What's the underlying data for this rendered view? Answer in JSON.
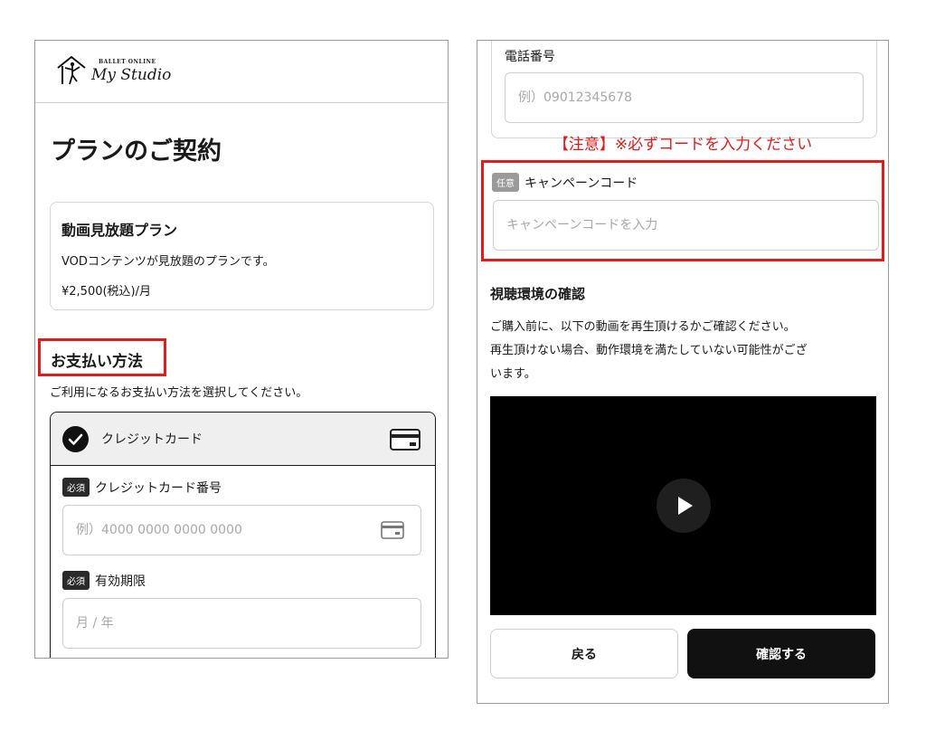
{
  "logo": {
    "small_text": "BALLET ONLINE",
    "main_text": "My Studio"
  },
  "page": {
    "title": "プランのご契約"
  },
  "plan": {
    "name": "動画見放題プラン",
    "description": "VODコンテンツが見放題のプランです。",
    "price": "¥2,500(税込)/月"
  },
  "payment": {
    "section_title": "お支払い方法",
    "description": "ご利用になるお支払い方法を選択してください。",
    "method_label": "クレジットカード",
    "required_badge": "必須",
    "card_number_label": "クレジットカード番号",
    "card_number_placeholder": "例）4000 0000 0000 0000",
    "expiry_label": "有効期限",
    "expiry_placeholder": "月 / 年"
  },
  "phone": {
    "label": "電話番号",
    "placeholder": "例）09012345678"
  },
  "notice": "【注意】※必ずコードを入力ください",
  "campaign": {
    "optional_badge": "任意",
    "label": "キャンペーンコード",
    "placeholder": "キャンペーンコードを入力"
  },
  "viewing": {
    "title": "視聴環境の確認",
    "line1": "ご購入前に、以下の動画を再生頂けるかご確認ください。",
    "line2": "再生頂けない場合、動作環境を満たしていない可能性がござ",
    "line3": "います。"
  },
  "buttons": {
    "back": "戻る",
    "confirm": "確認する"
  },
  "colors": {
    "accent_red": "#e41b1b",
    "dark": "#111111"
  }
}
